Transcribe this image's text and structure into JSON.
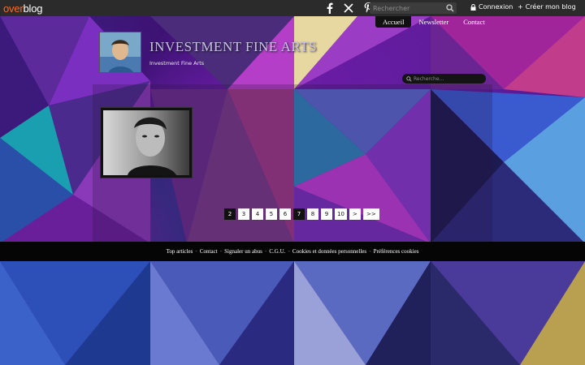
{
  "topbar": {
    "logo_over": "over",
    "logo_blog": "blog",
    "search_placeholder": "Rechercher",
    "login": "Connexion",
    "create": "Créer mon blog",
    "social": [
      "facebook-icon",
      "x-icon",
      "pinterest-icon"
    ]
  },
  "nav": {
    "items": [
      "Accueil",
      "Newsletter",
      "Contact"
    ],
    "active_index": 0
  },
  "header": {
    "title": "INVESTMENT FINE ARTS",
    "subtitle": "Investment Fine Arts",
    "search_placeholder": "Recherche..."
  },
  "pagination": {
    "pages": [
      "2",
      "3",
      "4",
      "5",
      "6",
      "7",
      "8",
      "9",
      "10",
      ">",
      ">>"
    ],
    "current": "2",
    "highlighted": "7"
  },
  "footer": {
    "links": [
      "Top articles",
      "Contact",
      "Signaler un abus",
      "C.G.U.",
      "Cookies et données personnelles",
      "Préférences cookies"
    ],
    "separator": "-"
  },
  "colors": {
    "accent": "#ff6a1f",
    "topbar_bg": "#2b2b2b",
    "footer_bg": "#050505"
  }
}
